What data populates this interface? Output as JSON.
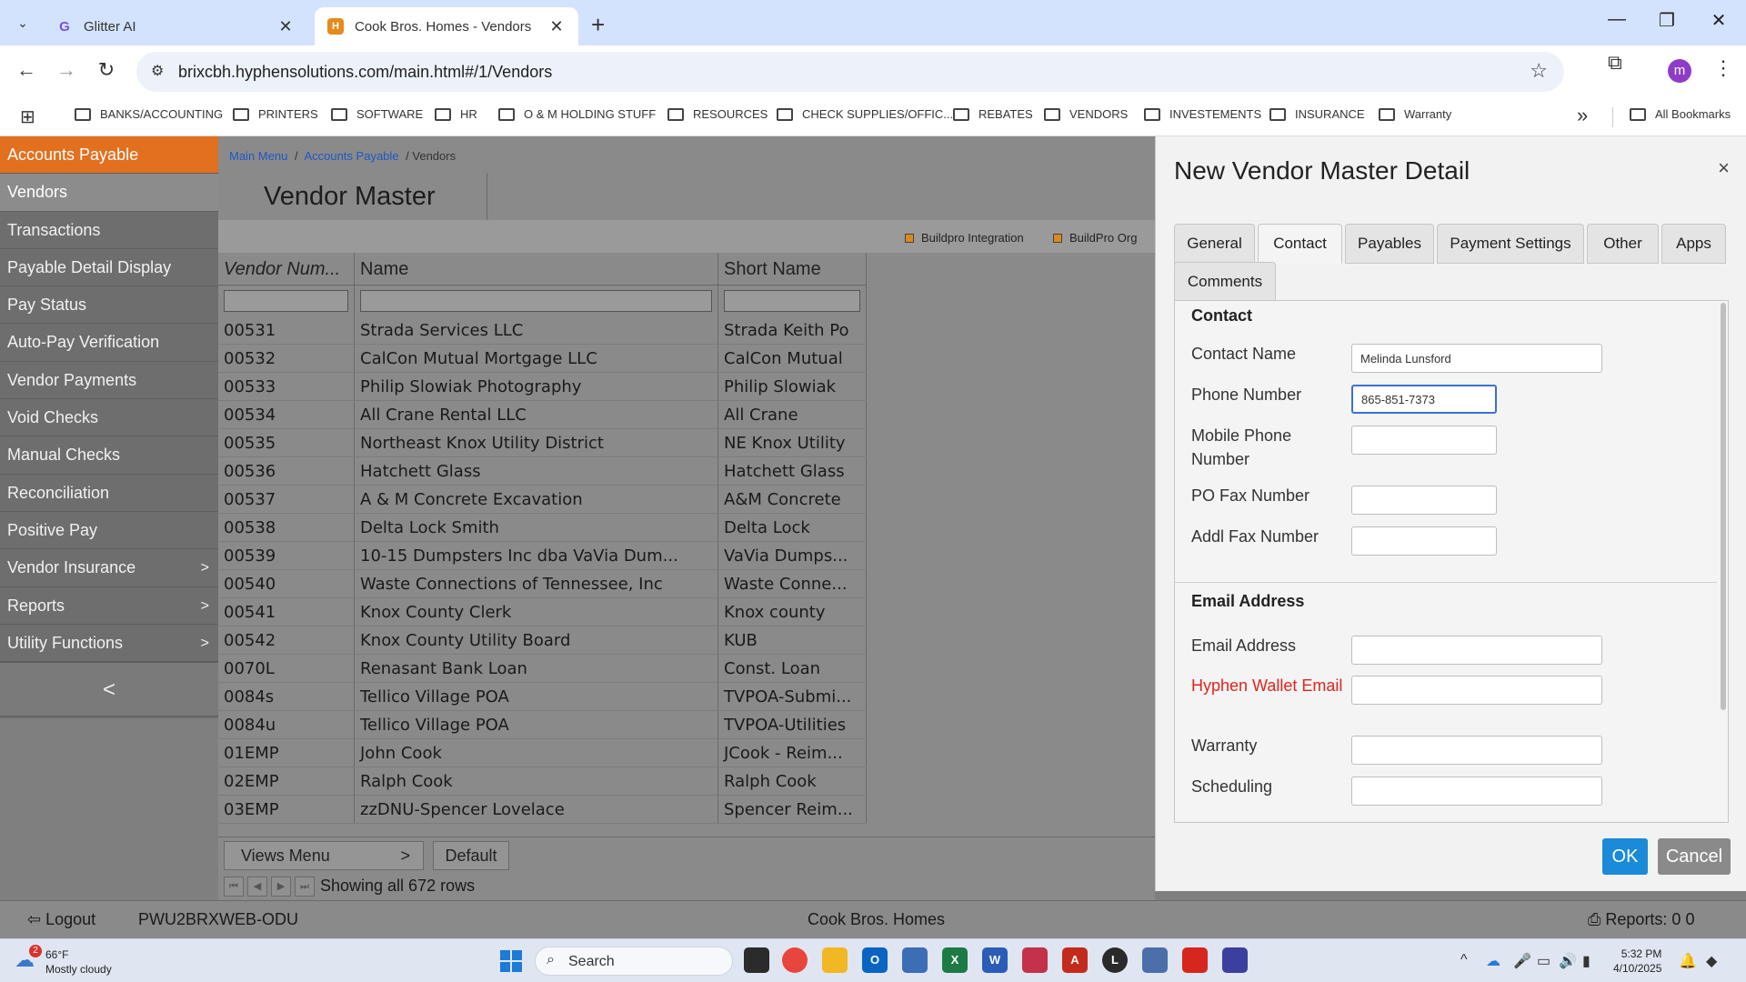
{
  "browser": {
    "tabs": [
      {
        "title": "Glitter AI",
        "active": false
      },
      {
        "title": "Cook Bros. Homes - Vendors",
        "active": true
      }
    ],
    "url": "brixcbh.hyphensolutions.com/main.html#/1/Vendors",
    "avatar_letter": "m",
    "bookmarks": [
      "BANKS/ACCOUNTING",
      "PRINTERS",
      "SOFTWARE",
      "HR",
      "O & M HOLDING STUFF",
      "RESOURCES",
      "CHECK SUPPLIES/OFFIC...",
      "REBATES",
      "VENDORS",
      "INVESTEMENTS",
      "INSURANCE",
      "Warranty"
    ],
    "all_bookmarks": "All Bookmarks"
  },
  "sidebar": {
    "items": [
      {
        "label": "Accounts Payable",
        "state": "header",
        "arrow": ""
      },
      {
        "label": "Vendors",
        "state": "selected",
        "arrow": ""
      },
      {
        "label": "Transactions",
        "state": "",
        "arrow": ""
      },
      {
        "label": "Payable Detail Display",
        "state": "",
        "arrow": ""
      },
      {
        "label": "Pay Status",
        "state": "",
        "arrow": ""
      },
      {
        "label": "Auto-Pay Verification",
        "state": "",
        "arrow": ""
      },
      {
        "label": "Vendor Payments",
        "state": "",
        "arrow": ""
      },
      {
        "label": "Void Checks",
        "state": "",
        "arrow": ""
      },
      {
        "label": "Manual Checks",
        "state": "",
        "arrow": ""
      },
      {
        "label": "Reconciliation",
        "state": "",
        "arrow": ""
      },
      {
        "label": "Positive Pay",
        "state": "",
        "arrow": ""
      },
      {
        "label": "Vendor Insurance",
        "state": "",
        "arrow": ">"
      },
      {
        "label": "Reports",
        "state": "",
        "arrow": ">"
      },
      {
        "label": "Utility Functions",
        "state": "",
        "arrow": ">"
      }
    ],
    "collapse": "<"
  },
  "main": {
    "breadcrumb": {
      "home": "Main Menu",
      "section": "Accounts Payable",
      "current": "/ Vendors",
      "sep": "/"
    },
    "title": "Vendor Master",
    "legend": [
      {
        "label": "Buildpro Integration",
        "color": "#d98a1a"
      },
      {
        "label": "BuildPro Org",
        "color": "#d98a1a"
      }
    ],
    "columns": [
      "Vendor Num...",
      "Name",
      "Short Name"
    ],
    "rows": [
      [
        "00531",
        "Strada Services LLC",
        "Strada Keith Po"
      ],
      [
        "00532",
        "CalCon Mutual Mortgage LLC",
        "CalCon Mutual"
      ],
      [
        "00533",
        "Philip Slowiak Photography",
        "Philip Slowiak"
      ],
      [
        "00534",
        "All Crane Rental LLC",
        "All Crane"
      ],
      [
        "00535",
        "Northeast Knox Utility District",
        "NE Knox Utility"
      ],
      [
        "00536",
        "Hatchett Glass",
        "Hatchett Glass"
      ],
      [
        "00537",
        "A & M Concrete Excavation",
        "A&M Concrete"
      ],
      [
        "00538",
        "Delta Lock Smith",
        "Delta Lock"
      ],
      [
        "00539",
        "10-15 Dumpsters Inc dba VaVia Dum...",
        "VaVia Dumps..."
      ],
      [
        "00540",
        "Waste Connections of Tennessee, Inc",
        "Waste Conne..."
      ],
      [
        "00541",
        "Knox County Clerk",
        "Knox county"
      ],
      [
        "00542",
        "Knox County Utility Board",
        "KUB"
      ],
      [
        "0070L",
        "Renasant Bank Loan",
        "Const. Loan"
      ],
      [
        "0084s",
        "Tellico Village POA",
        "TVPOA-Submi..."
      ],
      [
        "0084u",
        "Tellico Village POA",
        "TVPOA-Utilities"
      ],
      [
        "01EMP",
        "John Cook",
        "JCook - Reim..."
      ],
      [
        "02EMP",
        "Ralph Cook",
        "Ralph Cook"
      ],
      [
        "03EMP",
        "zzDNU-Spencer Lovelace",
        "Spencer Reim..."
      ]
    ],
    "views_menu": "Views Menu",
    "views_arrow": ">",
    "default_view": "Default",
    "pager_text": "Showing all 672 rows"
  },
  "dialog": {
    "title": "New Vendor Master Detail",
    "close": "×",
    "tabs": [
      "General",
      "Contact",
      "Payables",
      "Payment Settings",
      "Other",
      "Apps",
      "Comments"
    ],
    "active_tab": "Contact",
    "contact_section": "Contact",
    "email_section": "Email Address",
    "fields": {
      "contact_name": {
        "label": "Contact Name",
        "value": "Melinda Lunsford"
      },
      "phone": {
        "label": "Phone Number",
        "value": "865-851-7373"
      },
      "mobile": {
        "label": "Mobile Phone Number",
        "value": ""
      },
      "po_fax": {
        "label": "PO Fax Number",
        "value": ""
      },
      "addl_fax": {
        "label": "Addl Fax Number",
        "value": ""
      },
      "email": {
        "label": "Email Address",
        "value": ""
      },
      "hyphen_wallet": {
        "label": "Hyphen Wallet Email",
        "value": ""
      },
      "warranty": {
        "label": "Warranty",
        "value": ""
      },
      "scheduling": {
        "label": "Scheduling",
        "value": ""
      }
    },
    "ok": "OK",
    "cancel": "Cancel"
  },
  "footer": {
    "logout": "Logout",
    "server": "PWU2BRXWEB-ODU",
    "company": "Cook Bros. Homes",
    "reports": "Reports: 0 0"
  },
  "taskbar": {
    "weather_badge": "2",
    "temp": "66°F",
    "condition": "Mostly cloudy",
    "search": "Search",
    "time": "5:32 PM",
    "date": "4/10/2025"
  },
  "colors": {
    "sidebar_header": "#e2701f",
    "ok_button": "#1a8ad9",
    "required_label": "#e0241c",
    "link": "#1f58c4"
  }
}
